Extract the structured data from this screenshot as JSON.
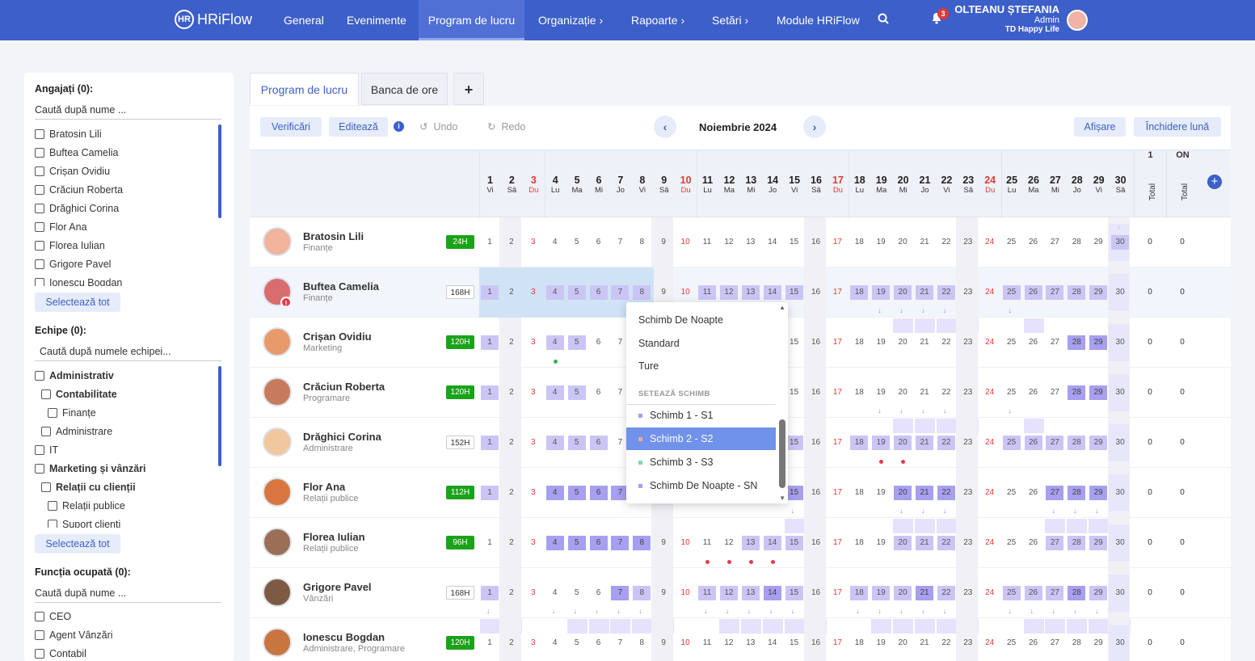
{
  "app": {
    "name": "HRiFlow",
    "logo_mark": "HR"
  },
  "nav": {
    "general": "General",
    "events": "Evenimente",
    "schedule": "Program de lucru",
    "org": "Organizație",
    "reports": "Rapoarte",
    "settings": "Setări",
    "modules": "Module HRiFlow",
    "chev": "›"
  },
  "notifications": {
    "count": "3",
    "icon": "bell-icon",
    "glyph": "🔔"
  },
  "user": {
    "name": "OLTEANU ȘTEFANIA",
    "role": "Admin",
    "company": "TD Happy Life"
  },
  "filters": {
    "employees_title": "Angajați (0):",
    "employees_search": "Caută după nume ...",
    "employees": [
      "Bratosin Lili",
      "Buftea Camelia",
      "Crișan Ovidiu",
      "Crăciun Roberta",
      "Drăghici Corina",
      "Flor Ana",
      "Florea Iulian",
      "Grigore Pavel",
      "Ionescu Bogdan"
    ],
    "select_all": "Selectează tot",
    "teams_title": "Echipe (0):",
    "teams_search": "Caută după numele echipei...",
    "teams": [
      {
        "label": "Administrativ",
        "level": 0,
        "bold": true
      },
      {
        "label": "Contabilitate",
        "level": 1,
        "bold": true
      },
      {
        "label": "Finanțe",
        "level": 2,
        "bold": false
      },
      {
        "label": "Administrare",
        "level": 1,
        "bold": false
      },
      {
        "label": "IT",
        "level": 0,
        "bold": false
      },
      {
        "label": "Marketing și vânzări",
        "level": 0,
        "bold": true
      },
      {
        "label": "Relații cu clienții",
        "level": 1,
        "bold": true
      },
      {
        "label": "Relații publice",
        "level": 2,
        "bold": false
      },
      {
        "label": "Suport clienți",
        "level": 2,
        "bold": false
      }
    ],
    "function_title": "Funcția ocupată (0):",
    "function_search": "Caută după nume ...",
    "functions": [
      "CEO",
      "Agent Vânzări",
      "Contabil"
    ]
  },
  "tabs": {
    "schedule": "Program de lucru",
    "hours_bank": "Banca de ore",
    "add": "+"
  },
  "toolbar": {
    "verify": "Verificări",
    "edit": "Editează",
    "info": "i",
    "undo": "Undo",
    "redo": "Redo",
    "month": "Noiembrie 2024",
    "prev": "‹",
    "next": "›",
    "display": "Afișare",
    "close_month": "Închidere lună"
  },
  "calendar": {
    "days": [
      {
        "d": "1",
        "w": "Vi"
      },
      {
        "d": "2",
        "w": "Sâ"
      },
      {
        "d": "3",
        "w": "Du"
      },
      {
        "d": "4",
        "w": "Lu"
      },
      {
        "d": "5",
        "w": "Ma"
      },
      {
        "d": "6",
        "w": "Mi"
      },
      {
        "d": "7",
        "w": "Jo"
      },
      {
        "d": "8",
        "w": "Vi"
      },
      {
        "d": "9",
        "w": "Sâ"
      },
      {
        "d": "10",
        "w": "Du"
      },
      {
        "d": "11",
        "w": "Lu"
      },
      {
        "d": "12",
        "w": "Ma"
      },
      {
        "d": "13",
        "w": "Mi"
      },
      {
        "d": "14",
        "w": "Jo"
      },
      {
        "d": "15",
        "w": "Vi"
      },
      {
        "d": "16",
        "w": "Sâ"
      },
      {
        "d": "17",
        "w": "Du"
      },
      {
        "d": "18",
        "w": "Lu"
      },
      {
        "d": "19",
        "w": "Ma"
      },
      {
        "d": "20",
        "w": "Mi"
      },
      {
        "d": "21",
        "w": "Jo"
      },
      {
        "d": "22",
        "w": "Vi"
      },
      {
        "d": "23",
        "w": "Sâ"
      },
      {
        "d": "24",
        "w": "Du"
      },
      {
        "d": "25",
        "w": "Lu"
      },
      {
        "d": "26",
        "w": "Ma"
      },
      {
        "d": "27",
        "w": "Mi"
      },
      {
        "d": "28",
        "w": "Jo"
      },
      {
        "d": "29",
        "w": "Vi"
      },
      {
        "d": "30",
        "w": "Sâ"
      }
    ],
    "sum_cols": [
      {
        "head": "1",
        "label": "Total"
      },
      {
        "head": "ON",
        "label": "Total"
      }
    ],
    "add_icon": "+"
  },
  "employees": [
    {
      "name": "Bratosin Lili",
      "dept": "Finanțe",
      "hours": "24H",
      "hours_style": "g",
      "avatar": "#f2b39b",
      "plan": [
        30
      ],
      "plan_dark": [],
      "sum": [
        "0",
        "0"
      ]
    },
    {
      "name": "Buftea Camelia",
      "dept": "Finanțe",
      "hours": "168H",
      "hours_style": "w",
      "avatar": "#d96d6d",
      "plan": [
        1,
        4,
        5,
        6,
        7,
        8,
        11,
        12,
        13,
        14,
        15,
        18,
        19,
        20,
        21,
        22,
        25,
        26,
        27,
        28,
        29
      ],
      "plan_dark": [],
      "sum": [
        "0",
        "0"
      ],
      "warning": "!"
    },
    {
      "name": "Crișan Ovidiu",
      "dept": "Marketing",
      "hours": "120H",
      "hours_style": "g",
      "avatar": "#e89a6a",
      "plan": [
        1,
        4,
        5
      ],
      "plan_dark": [
        28,
        29
      ],
      "sum": [
        "0",
        "0"
      ]
    },
    {
      "name": "Crăciun Roberta",
      "dept": "Programare",
      "hours": "120H",
      "hours_style": "g",
      "avatar": "#c77b5c",
      "plan": [
        1,
        4,
        5
      ],
      "plan_dark": [
        28,
        29
      ],
      "sum": [
        "0",
        "0"
      ]
    },
    {
      "name": "Drăghici Corina",
      "dept": "Administrare",
      "hours": "152H",
      "hours_style": "w",
      "avatar": "#f1c79d",
      "plan": [
        1,
        4,
        5,
        6,
        15,
        18,
        19,
        20,
        21,
        22,
        25,
        26,
        27,
        28,
        29
      ],
      "plan_dark": [],
      "sum": [
        "0",
        "0"
      ]
    },
    {
      "name": "Flor Ana",
      "dept": "Relații publice",
      "hours": "112H",
      "hours_style": "g",
      "avatar": "#d9763f",
      "plan": [
        1
      ],
      "plan_dark": [
        4,
        5,
        6,
        7,
        8,
        15,
        20,
        21,
        22,
        27,
        28,
        29
      ],
      "sum": [
        "0",
        "0"
      ]
    },
    {
      "name": "Florea Iulian",
      "dept": "Relații publice",
      "hours": "96H",
      "hours_style": "g",
      "avatar": "#9b6f55",
      "plan": [
        13,
        14,
        15,
        20,
        21,
        22,
        27,
        28,
        29
      ],
      "plan_dark": [
        4,
        5,
        6,
        7,
        8
      ],
      "sum": [
        "0",
        "0"
      ]
    },
    {
      "name": "Grigore Pavel",
      "dept": "Vânzări",
      "hours": "168H",
      "hours_style": "w",
      "avatar": "#7f5a43",
      "plan": [
        1,
        8,
        11,
        12,
        13,
        15,
        18,
        19,
        20,
        22,
        25,
        26,
        27,
        29
      ],
      "plan_dark": [
        7,
        14,
        21,
        28
      ],
      "sum": [
        "0",
        "0"
      ]
    },
    {
      "name": "Ionescu Bogdan",
      "dept": "Administrare, Programare",
      "hours": "120H",
      "hours_style": "g",
      "avatar": "#c9753f",
      "plan": [],
      "plan_dark": [],
      "sum": [
        "0",
        "0"
      ]
    }
  ],
  "shift_menu": {
    "templates": [
      "Schimb De Noapte",
      "Standard",
      "Ture"
    ],
    "section": "SETEAZĂ SCHIMB",
    "shifts": [
      {
        "label": "Schimb 1 - S1",
        "color": "#a79ff0"
      },
      {
        "label": "Schimb 2 - S2",
        "color": "#f3a6a0"
      },
      {
        "label": "Schimb 3 - S3",
        "color": "#7fd9b0"
      },
      {
        "label": "Schimb De Noapte - SN",
        "color": "#a79ff0"
      }
    ],
    "active_index": 1,
    "up": "▲",
    "down": "▼"
  },
  "colors": {
    "accent": "#3d5fc9",
    "shift": "#cbc5f5",
    "shift_dark": "#a79ff0",
    "weekend": "#e53935",
    "dot_green": "#34b34a",
    "dot_red": "#e8384f"
  }
}
